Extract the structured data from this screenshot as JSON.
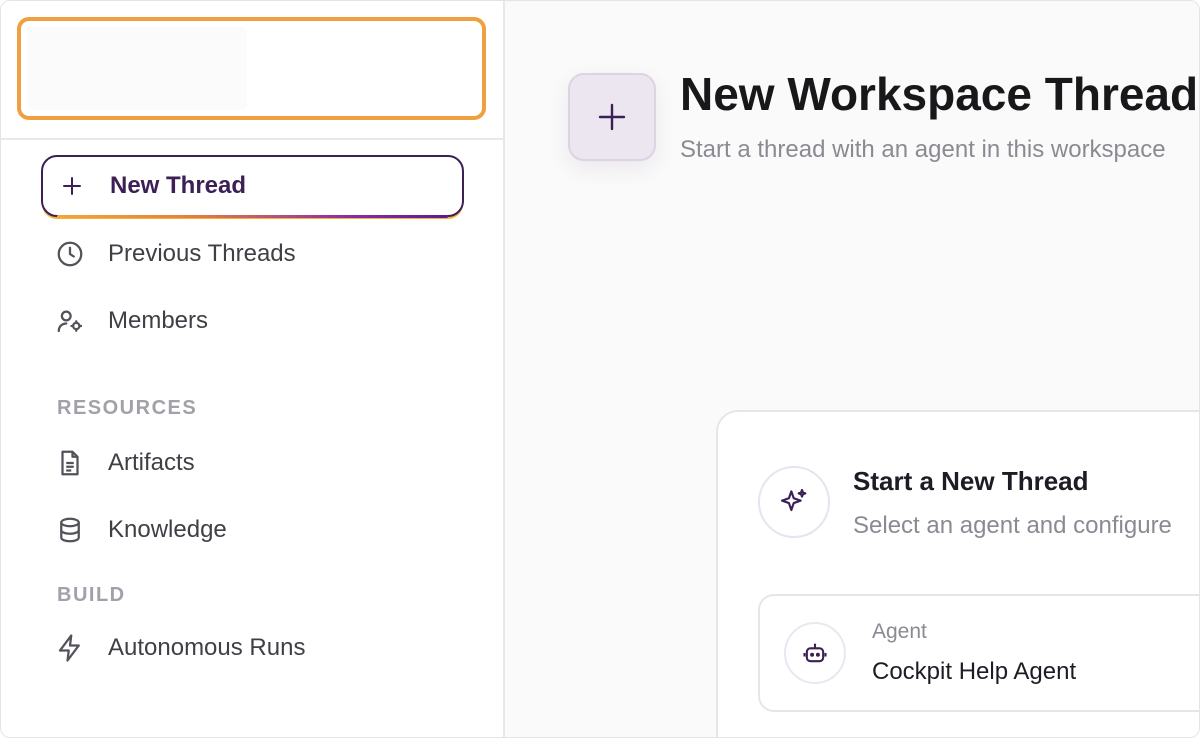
{
  "sidebar": {
    "nav": {
      "new_thread": "New Thread",
      "previous_threads": "Previous Threads",
      "members": "Members"
    },
    "resources": {
      "title": "RESOURCES",
      "artifacts": "Artifacts",
      "knowledge": "Knowledge"
    },
    "build": {
      "title": "BUILD",
      "autonomous_runs": "Autonomous Runs"
    }
  },
  "main": {
    "title": "New Workspace Thread",
    "subtitle": "Start a thread with an agent in this workspace",
    "card": {
      "title": "Start a New Thread",
      "subtitle": "Select an agent and configure",
      "agent_caption": "Agent",
      "agent_name": "Cockpit Help Agent"
    }
  },
  "colors": {
    "accent": "#3b1f55",
    "highlight": "#f0a040",
    "gradient_start": "#f0a73a",
    "gradient_end": "#5b1c8c"
  },
  "icons": [
    "plus-icon",
    "clock-icon",
    "members-icon",
    "document-icon",
    "database-icon",
    "lightning-icon",
    "sparkles-icon",
    "robot-icon"
  ]
}
